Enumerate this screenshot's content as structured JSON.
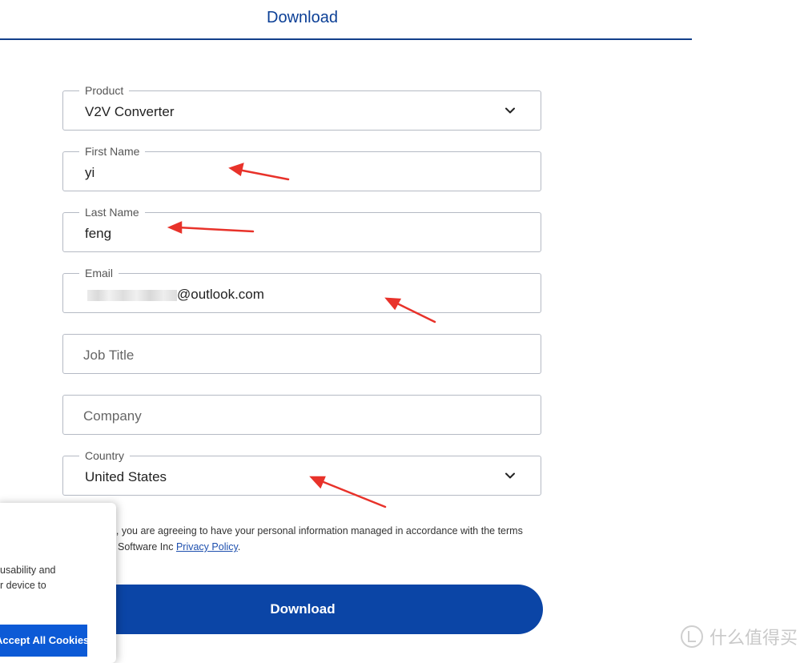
{
  "header": {
    "title": "Download"
  },
  "form": {
    "product": {
      "label": "Product",
      "value": "V2V Converter"
    },
    "first_name": {
      "label": "First Name",
      "value": "yi"
    },
    "last_name": {
      "label": "Last Name",
      "value": "feng"
    },
    "email": {
      "label": "Email",
      "value_visible": "@outlook.com"
    },
    "job_title": {
      "placeholder": "Job Title"
    },
    "company": {
      "placeholder": "Company"
    },
    "country": {
      "label": "Country",
      "value": "United States"
    },
    "consent": {
      "line1": "ng, you are agreeing to have your personal information managed in accordance with the terms",
      "line2_prefix": "Software Inc ",
      "policy_link": "Privacy Policy",
      "line2_suffix": "."
    },
    "submit_label": "Download"
  },
  "cookie_banner": {
    "text_line1": "usability and",
    "text_line2": "r device to",
    "accept_label": "Accept All Cookies"
  },
  "watermark": {
    "text": "什么值得买"
  },
  "colors": {
    "accent": "#0b45a6",
    "title": "#0b3f96",
    "annotation_arrow": "#e8322a",
    "cookie_button": "#0c5ad6"
  }
}
